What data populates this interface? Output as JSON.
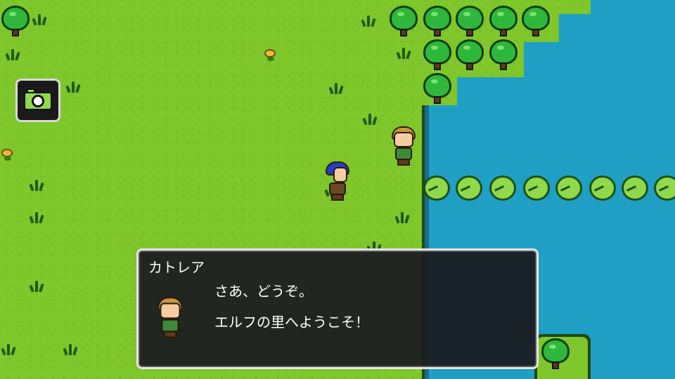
{
  "dialog": {
    "speaker": "カトレア",
    "lines": [
      "さあ、どうぞ。",
      "エルフの里へようこそ！"
    ]
  },
  "hud": {
    "camera_icon": "camera-icon"
  },
  "colors": {
    "grass": "#7fc62b",
    "water": "#1f9fc6",
    "dialog_bg": "#1c1c20",
    "dialog_border": "#e6e6e6",
    "text": "#ffffff"
  }
}
